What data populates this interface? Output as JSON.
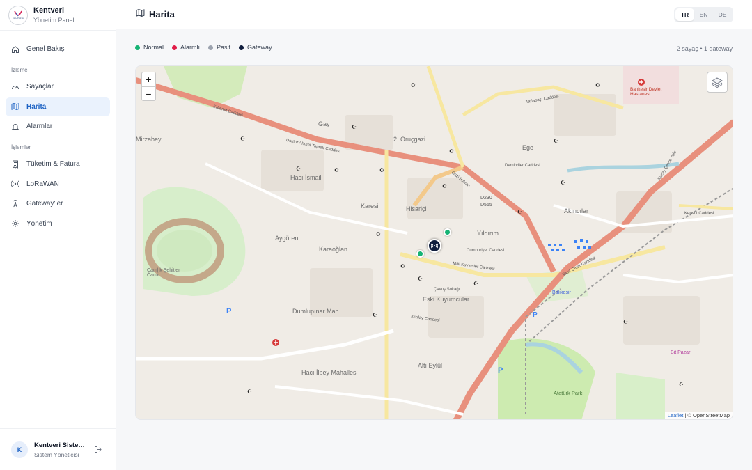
{
  "brand": {
    "title": "Kentveri",
    "subtitle": "Yönetim Paneli",
    "logo_text": "KENTVERI"
  },
  "nav": {
    "overview": "Genel Bakış",
    "section_monitoring": "İzleme",
    "meters": "Sayaçlar",
    "map": "Harita",
    "alarms": "Alarmlar",
    "section_operations": "İşlemler",
    "billing": "Tüketim & Fatura",
    "lorawan": "LoRaWAN",
    "gateways": "Gateway'ler",
    "admin": "Yönetim"
  },
  "user": {
    "initial": "K",
    "name": "Kentveri Sistem Yöneticisi",
    "role": "Sistem Yöneticisi"
  },
  "header": {
    "title": "Harita"
  },
  "languages": [
    "TR",
    "EN",
    "DE"
  ],
  "legend": {
    "normal": "Normal",
    "alarm": "Alarmlı",
    "passive": "Pasif",
    "gateway": "Gateway"
  },
  "colors": {
    "normal": "#16b374",
    "alarm": "#e11d48",
    "passive": "#9ca3af",
    "gateway": "#0f1d3d",
    "accent": "#1e63c4"
  },
  "summary": "2 sayaç • 1 gateway",
  "map": {
    "zoom_in": "+",
    "zoom_out": "−",
    "attribution_leaflet": "Leaflet",
    "attribution_rest": "| © OpenStreetMap",
    "places": {
      "mirzabey": "Mirzabey",
      "gay": "Gay",
      "orucgazi": "2. Oruçgazi",
      "ege": "Ege",
      "haciismail": "Hacı İsmail",
      "karesi": "Karesi",
      "hisarici": "Hisariçi",
      "yildirim": "Yıldırım",
      "akincilar": "Akıncılar",
      "aygoren": "Aygören",
      "karaoglan": "Karaoğlan",
      "eskikuyumcular": "Eski Kuyumcular",
      "dumlupinar": "Dumlupınar Mah.",
      "altieylul": "Altı Eylül",
      "haciilbey": "Hacı İlbey Mahallesi",
      "camlik": "Çamlık Şehitler Camii",
      "hospital": "Balıkesir Devlet Hastanesi",
      "station": "Balıkesir",
      "park": "Atatürk Parkı",
      "bitpazari": "Bit Pazarı"
    },
    "streets": {
      "edremit": "Edremit Caddesi",
      "toprak": "Doktor Ahmet Toprak Caddesi",
      "tarlabasi": "Tarlabaşı Caddesi",
      "demirciler": "Demirciler Caddesi",
      "gazibulvari": "Gazi Bulvarı",
      "milli": "Milli Kuvvetler Caddesi",
      "vasif": "Vasıf Çınar Caddesi",
      "cumhuriyet": "Cumhuriyet Caddesi",
      "kuzey": "Kuzey Çevre Yolu",
      "d230": "D230",
      "d555": "D555",
      "kepsut": "Kepsut Caddesi",
      "kizilay": "Kızılay Caddesi",
      "cavus": "Çavuş Sokağı"
    }
  }
}
